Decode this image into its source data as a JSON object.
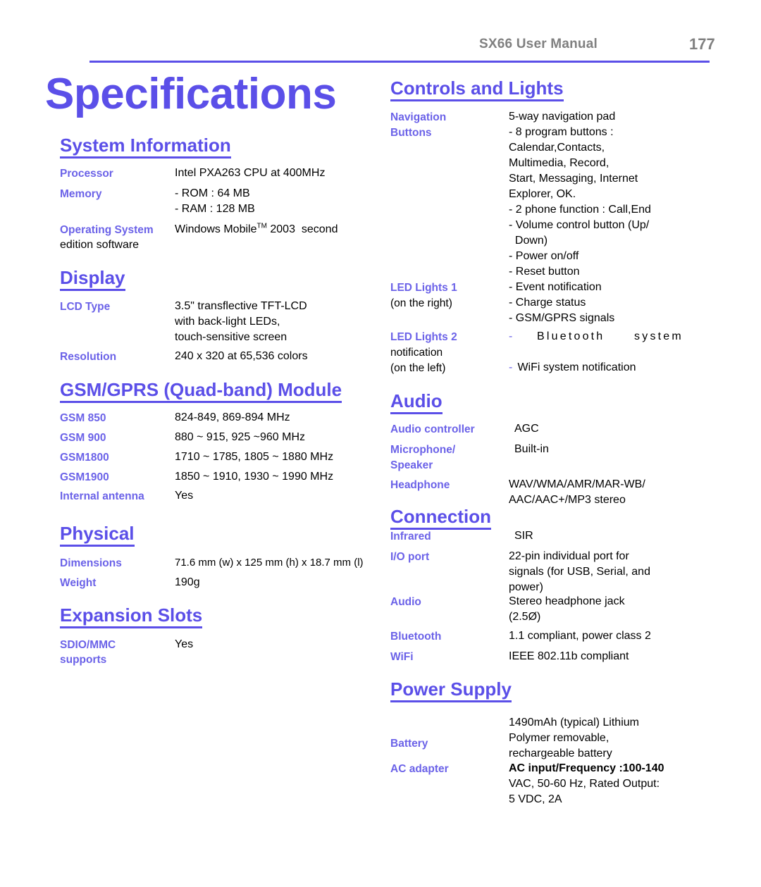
{
  "header": {
    "title": "SX66 User Manual",
    "page_number": "177"
  },
  "page_title": "Specifications",
  "colors": {
    "heading_blue": "#5B4FE8",
    "label_blue": "#6B62E8",
    "header_gray": "#808080",
    "body_black": "#000000"
  },
  "left_column": {
    "sections": [
      {
        "heading": "System Information",
        "rows": [
          {
            "label": "Processor",
            "value": "Intel PXA263 CPU at 400MHz"
          },
          {
            "label": "Memory",
            "value_line1": "- ROM : 64 MB",
            "value_line2": "- RAM : 128 MB"
          },
          {
            "label": "Operating System",
            "value_prefix": "Windows Mobile",
            "value_sup": "TM",
            "value_suffix": " 2003  second",
            "wrap_line": "edition software"
          }
        ]
      },
      {
        "heading": "Display",
        "rows": [
          {
            "label": "LCD Type",
            "value_line1": "3.5\" transflective TFT-LCD",
            "value_line2": "with back-light LEDs,",
            "value_line3": "touch-sensitive screen"
          },
          {
            "label": "Resolution",
            "value": "240 x 320 at 65,536 colors"
          }
        ]
      },
      {
        "heading": "GSM/GPRS (Quad-band) Module",
        "rows": [
          {
            "label": "GSM 850",
            "value": "824-849, 869-894 MHz"
          },
          {
            "label": "GSM 900",
            "value": "880 ~ 915, 925 ~960 MHz"
          },
          {
            "label": "GSM1800",
            "value": "1710 ~ 1785, 1805 ~ 1880 MHz"
          },
          {
            "label": "GSM1900",
            "value": "1850 ~ 1910, 1930 ~ 1990 MHz"
          },
          {
            "label": "Internal antenna",
            "value": "Yes"
          }
        ]
      },
      {
        "heading": "Physical",
        "rows": [
          {
            "label": "Dimensions",
            "value": "71.6 mm (w) x 125 mm (h) x 18.7 mm (l)"
          },
          {
            "label": "Weight",
            "value": "190g"
          }
        ]
      },
      {
        "heading": "Expansion Slots",
        "rows": [
          {
            "label_line1": "SDIO/MMC",
            "label_line2": "supports",
            "value": "Yes"
          }
        ]
      }
    ]
  },
  "right_column": {
    "sections": [
      {
        "heading": "Controls and Lights",
        "rows": [
          {
            "label_line1": "Navigation",
            "label_line2": "Buttons",
            "value_lines": [
              "5-way navigation pad",
              "- 8 program buttons :",
              "Calendar,Contacts,",
              "Multimedia, Record,",
              "Start, Messaging, Internet",
              "Explorer, OK.",
              "- 2 phone function : Call,End",
              "- Volume control button (Up/",
              "  Down)",
              "- Power on/off",
              "- Reset button"
            ]
          },
          {
            "label_line1": "LED Lights 1",
            "label_line2": "(on the right)",
            "value_lines": [
              "- Event notification",
              "- Charge status",
              "- GSM/GPRS signals"
            ]
          },
          {
            "label_line1": "LED Lights 2",
            "label_line2": "notification",
            "label_line3": "(on the left)",
            "value_bluetooth_dash": "-",
            "value_bluetooth": "Bluetooth system",
            "value_wifi_dash": "-",
            "value_wifi": " WiFi system notification"
          }
        ]
      },
      {
        "heading": "Audio",
        "rows": [
          {
            "label": "Audio controller",
            "value": "AGC"
          },
          {
            "label_line1": "Microphone/",
            "label_line2": "Speaker",
            "value": "Built-in"
          },
          {
            "label": "Headphone",
            "value_line1": "WAV/WMA/AMR/MAR-WB/",
            "value_line2": "AAC/AAC+/MP3 stereo"
          }
        ]
      },
      {
        "heading": "Connection",
        "rows": [
          {
            "label": "Infrared",
            "value": "SIR"
          },
          {
            "label": "I/O port",
            "value_line1": "22-pin individual port for",
            "value_line2": "signals (for USB, Serial, and",
            "value_line3": "power)"
          },
          {
            "label": "Audio",
            "value_line1": "Stereo headphone jack",
            "value_line2": "(2.5Ø)"
          },
          {
            "label": "Bluetooth",
            "value": "1.1 compliant, power class 2"
          },
          {
            "label": "WiFi",
            "value": "IEEE 802.11b compliant"
          }
        ]
      },
      {
        "heading": "Power Supply",
        "rows": [
          {
            "label": "Battery",
            "value_line1": "1490mAh (typical) Lithium",
            "value_line2": "Polymer removable,",
            "value_line3": "rechargeable battery"
          },
          {
            "label": "AC adapter",
            "value_line1": "AC input/Frequency :100-140",
            "value_line2_bold": "VAC",
            "value_line2_rest": ", 50-60 Hz, Rated Output:",
            "value_line3": "5 VDC, 2A"
          }
        ]
      }
    ]
  }
}
